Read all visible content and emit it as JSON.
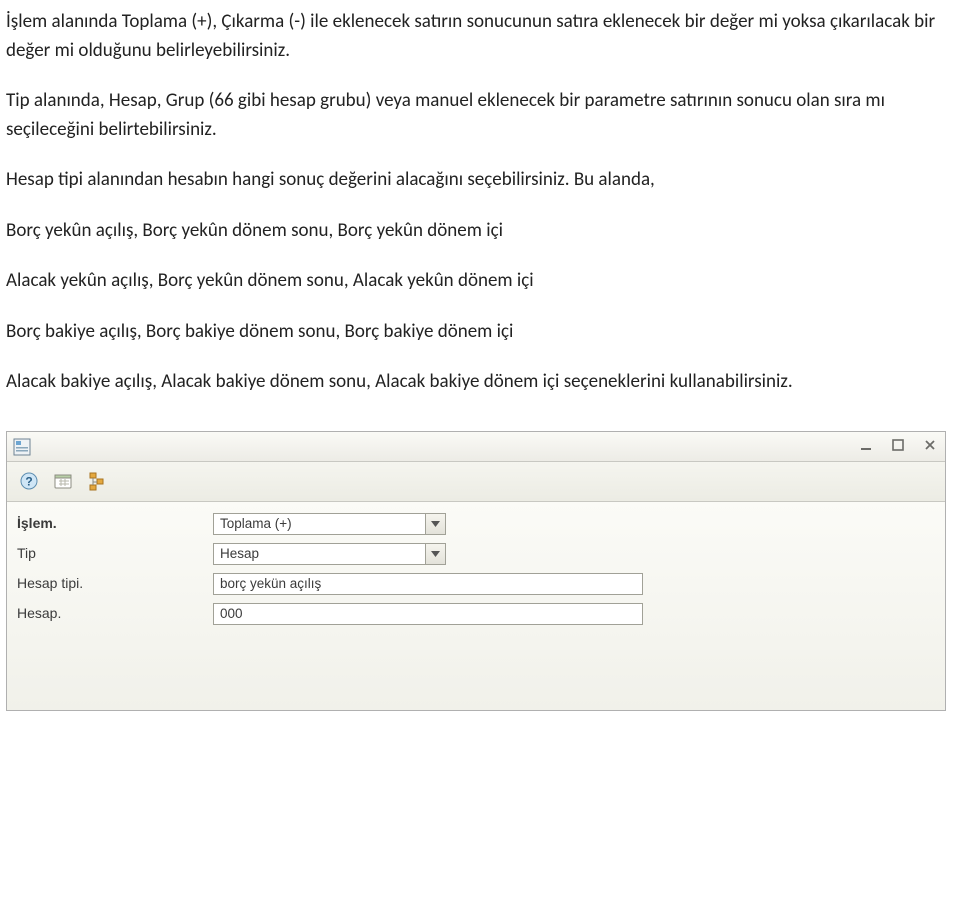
{
  "body": {
    "p1": "İşlem alanında Toplama (+), Çıkarma (-) ile eklenecek satırın sonucunun satıra eklenecek bir değer mi yoksa çıkarılacak bir değer mi olduğunu belirleyebilirsiniz.",
    "p2": "Tip alanında, Hesap, Grup (66 gibi hesap grubu) veya manuel eklenecek bir parametre satırının sonucu olan sıra mı seçileceğini belirtebilirsiniz.",
    "p3": "Hesap tipi alanından hesabın hangi sonuç değerini alacağını seçebilirsiniz. Bu alanda,",
    "p4": "Borç yekûn açılış, Borç yekûn dönem sonu, Borç yekûn dönem içi",
    "p5": "Alacak yekûn açılış, Borç yekûn dönem sonu, Alacak yekûn dönem içi",
    "p6": "Borç bakiye açılış, Borç bakiye dönem sonu, Borç bakiye dönem içi",
    "p7": "Alacak bakiye açılış, Alacak bakiye dönem sonu, Alacak bakiye dönem içi seçeneklerini kullanabilirsiniz."
  },
  "form": {
    "labels": {
      "islem": "İşlem.",
      "tip": "Tip",
      "hesap_tipi": "Hesap tipi.",
      "hesap": "Hesap."
    },
    "values": {
      "islem": "Toplama (+)",
      "tip": "Hesap",
      "hesap_tipi": "borç yekün açılış",
      "hesap": "000"
    }
  }
}
